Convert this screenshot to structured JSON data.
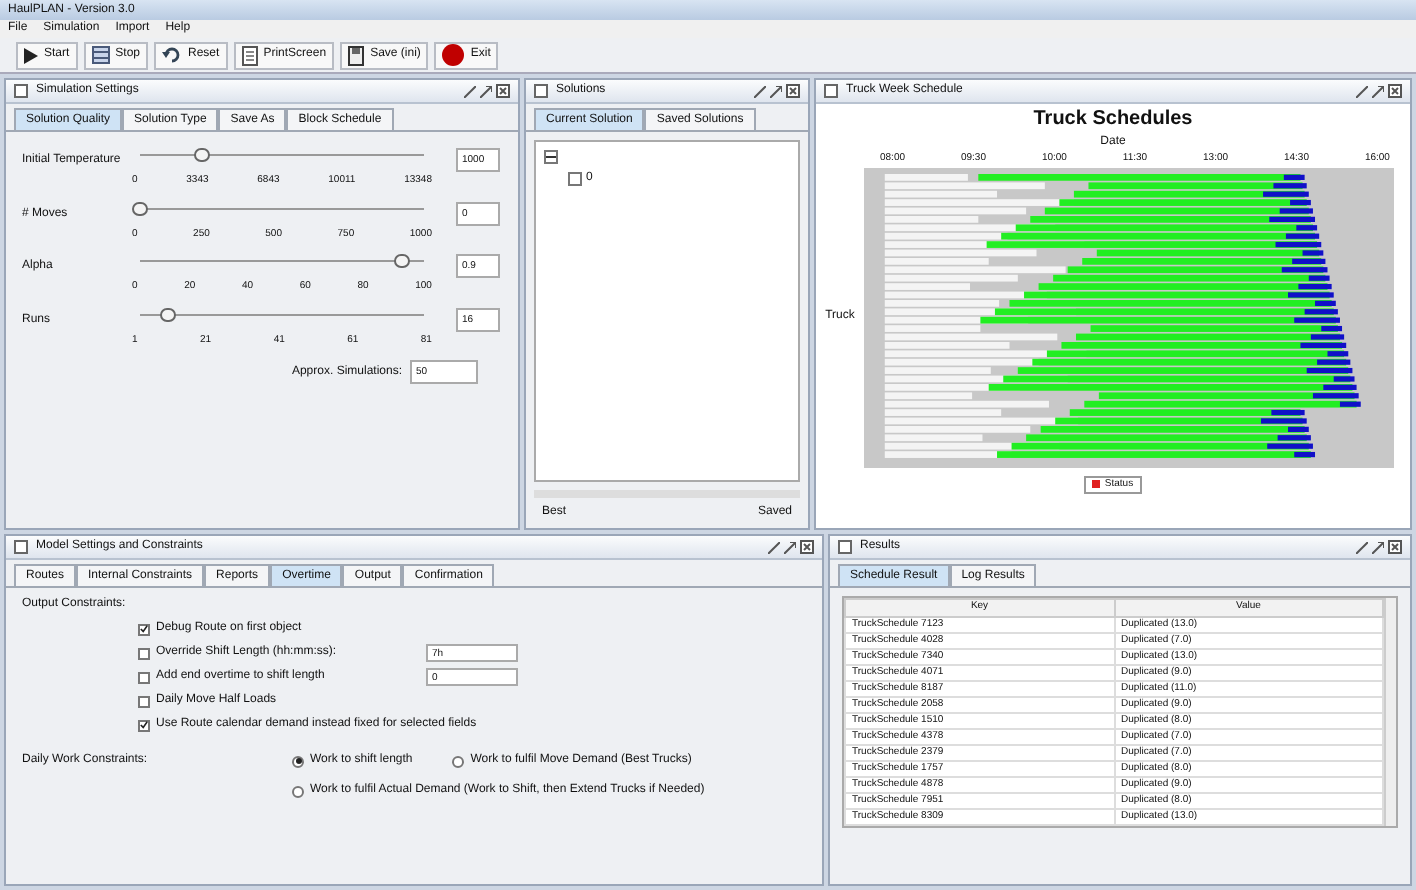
{
  "window": {
    "title": "HaulPLAN - Version 3.0"
  },
  "menu": [
    "File",
    "Simulation",
    "Import",
    "Help"
  ],
  "toolbar": [
    {
      "label": "Start",
      "kind": "play"
    },
    {
      "label": "Stop",
      "kind": "stop"
    },
    {
      "label": "Reset",
      "kind": "reset"
    },
    {
      "label": "PrintScreen",
      "kind": "print"
    },
    {
      "label": "Save (ini)",
      "kind": "save"
    },
    {
      "label": "Exit",
      "kind": "exit"
    }
  ],
  "simulation_settings": {
    "title": "Simulation Settings",
    "tabs": [
      {
        "label": "Solution Quality",
        "selected": true
      },
      {
        "label": "Solution Type",
        "selected": false
      },
      {
        "label": "Save As",
        "selected": false
      },
      {
        "label": "Block Schedule",
        "selected": false
      }
    ],
    "sliders": [
      {
        "label": "Initial Temperature",
        "level": 0.22,
        "ticks": [
          "0",
          "3343",
          "6843",
          "10011",
          "13348"
        ],
        "value": "1000"
      },
      {
        "label": "# Moves",
        "level": 0,
        "ticks": [
          "0",
          "250",
          "500",
          "750",
          "1000"
        ],
        "value": "0"
      },
      {
        "label": "Alpha",
        "level": 0.92,
        "ticks": [
          "0",
          "20",
          "40",
          "60",
          "80",
          "100"
        ],
        "value": "0.9"
      },
      {
        "label": "Runs",
        "level": 0.1,
        "ticks": [
          "1",
          "21",
          "41",
          "61",
          "81"
        ],
        "value": "16"
      }
    ],
    "approx_label": "Approx. Simulations:",
    "approx_value": "50"
  },
  "solutions": {
    "title": "Solutions",
    "tabs": [
      {
        "label": "Current Solution",
        "selected": true
      },
      {
        "label": "Saved Solutions",
        "selected": false
      }
    ],
    "tree": [
      {
        "expanded": true,
        "children": [
          {
            "label": "0",
            "expanded": false
          }
        ]
      }
    ],
    "footer_left": "Best",
    "footer_right": "Saved"
  },
  "schedule": {
    "title": "Truck Week Schedule",
    "chart_title": "Truck Schedules",
    "xlabel": "Date",
    "ylabel": "Truck",
    "xticks": [
      "08:00",
      "09:30",
      "10:00",
      "11:30",
      "13:00",
      "14:30",
      "16:00"
    ],
    "legend": "Status"
  },
  "model_settings": {
    "title": "Model Settings and Constraints",
    "tabs": [
      {
        "label": "Routes",
        "selected": false
      },
      {
        "label": "Internal Constraints",
        "selected": false
      },
      {
        "label": "Reports",
        "selected": false
      },
      {
        "label": "Overtime",
        "selected": true
      },
      {
        "label": "Output",
        "selected": false
      },
      {
        "label": "Confirmation",
        "selected": false
      }
    ],
    "group_label": "Output Constraints:",
    "options": [
      {
        "label": "Debug Route on first object",
        "checked": true
      },
      {
        "label": "Override Shift Length (hh:mm:ss):",
        "checked": false,
        "value": "7h"
      },
      {
        "label": "Add end overtime to shift length",
        "checked": false,
        "value": "0"
      },
      {
        "label": "Daily Move Half Loads",
        "checked": false
      },
      {
        "label": "Use Route calendar demand instead fixed for selected fields",
        "checked": true
      }
    ],
    "daily_label": "Daily Work Constraints:",
    "radios": [
      {
        "label": "Work to shift length",
        "selected": true
      },
      {
        "label": "Work to fulfil Move Demand (Best Trucks)",
        "selected": false
      },
      {
        "label": "Work to fulfil Actual Demand (Work to Shift, then Extend Trucks if Needed)",
        "selected": false
      }
    ]
  },
  "results": {
    "title": "Results",
    "tabs": [
      {
        "label": "Schedule Result",
        "selected": true
      },
      {
        "label": "Log Results",
        "selected": false
      }
    ],
    "columns": [
      "Key",
      "Value"
    ],
    "rows": [
      [
        "TruckSchedule 7123",
        "Duplicated (13.0)"
      ],
      [
        "TruckSchedule 4028",
        "Duplicated (7.0)"
      ],
      [
        "TruckSchedule 7340",
        "Duplicated (13.0)"
      ],
      [
        "TruckSchedule 4071",
        "Duplicated (9.0)"
      ],
      [
        "TruckSchedule 8187",
        "Duplicated (11.0)"
      ],
      [
        "TruckSchedule 2058",
        "Duplicated (9.0)"
      ],
      [
        "TruckSchedule 1510",
        "Duplicated (8.0)"
      ],
      [
        "TruckSchedule 4378",
        "Duplicated (7.0)"
      ],
      [
        "TruckSchedule 2379",
        "Duplicated (7.0)"
      ],
      [
        "TruckSchedule 1757",
        "Duplicated (8.0)"
      ],
      [
        "TruckSchedule 4878",
        "Duplicated (9.0)"
      ],
      [
        "TruckSchedule 7951",
        "Duplicated (8.0)"
      ],
      [
        "TruckSchedule 8309",
        "Duplicated (13.0)"
      ]
    ]
  }
}
